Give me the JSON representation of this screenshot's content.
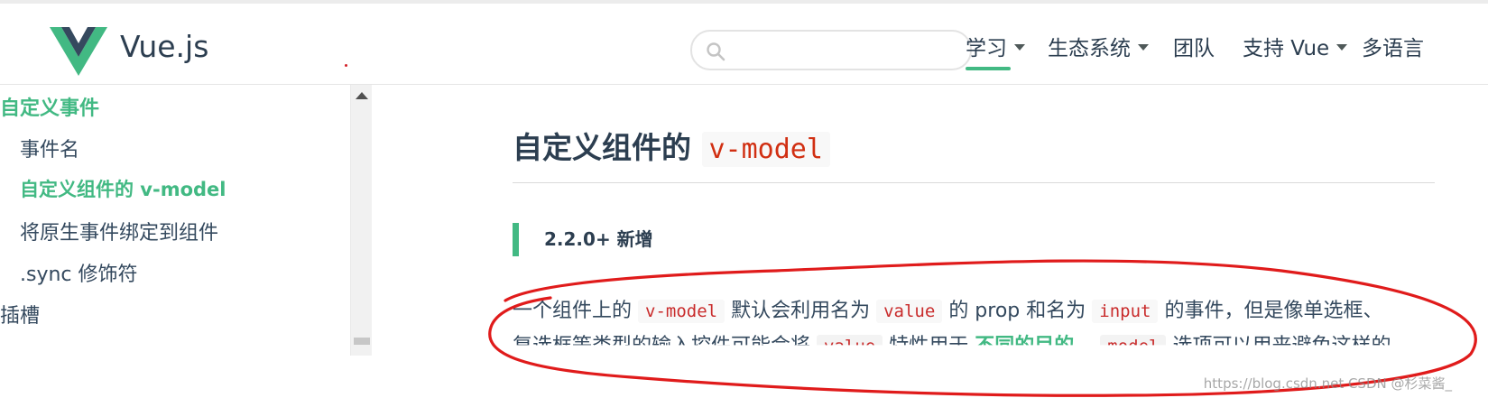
{
  "header": {
    "brand": "Vue.js",
    "search": {
      "value": "",
      "placeholder": ""
    },
    "nav": [
      {
        "label": "学习",
        "has_dropdown": true,
        "active": true
      },
      {
        "label": "生态系统",
        "has_dropdown": true
      },
      {
        "label": "团队",
        "has_dropdown": false
      },
      {
        "label": "支持 Vue",
        "has_dropdown": true
      },
      {
        "label": "多语言",
        "has_dropdown": false
      }
    ]
  },
  "sidebar": {
    "items": [
      {
        "label": "自定义事件",
        "level": 0,
        "active": true
      },
      {
        "label": "事件名",
        "level": 1
      },
      {
        "label": "自定义组件的 v-model",
        "level": 1,
        "active": true
      },
      {
        "label": "将原生事件绑定到组件",
        "level": 1
      },
      {
        "label": ".sync 修饰符",
        "level": 1
      },
      {
        "label": "插槽",
        "level": 0
      }
    ]
  },
  "main": {
    "heading_text": "自定义组件的",
    "heading_code": "v-model",
    "tip": "2.2.0+ 新增",
    "para": {
      "t1": "一个组件上的",
      "c1": "v-model",
      "t2": "默认会利用名为",
      "c2": "value",
      "t3": "的 prop 和名为",
      "c3": "input",
      "t4": "的事件，但是像单选框、"
    },
    "para2": {
      "t1": "复选框等类型的输入控件可能会将",
      "c1": "value",
      "t2": "特性用于",
      "link": "不同的目的",
      "t3": "。",
      "c2": "model",
      "t4": "选项可以用来避免这样的"
    }
  },
  "watermark": "https://blog.csdn.net CSDN @杉菜酱_",
  "colors": {
    "accent": "#42b983",
    "text": "#2c3e50",
    "annotation": "#e01b1b"
  }
}
